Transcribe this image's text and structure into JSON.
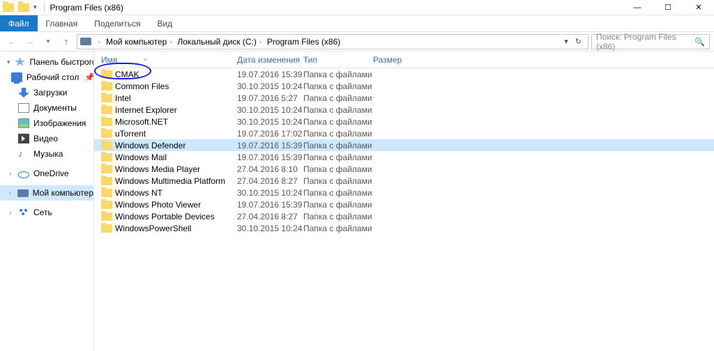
{
  "window": {
    "title": "Program Files (x86)"
  },
  "tabs": {
    "file": "Файл",
    "home": "Главная",
    "share": "Поделиться",
    "view": "Вид"
  },
  "breadcrumb": [
    {
      "label": "Мой компьютер"
    },
    {
      "label": "Локальный диск (C:)"
    },
    {
      "label": "Program Files (x86)"
    }
  ],
  "search": {
    "placeholder": "Поиск: Program Files (x86)"
  },
  "sidebar": {
    "quick": {
      "label": "Панель быстрого доступа"
    },
    "desktop": "Рабочий стол",
    "downloads": "Загрузки",
    "documents": "Документы",
    "pictures": "Изображения",
    "videos": "Видео",
    "music": "Музыка",
    "onedrive": "OneDrive",
    "thispc": "Мой компьютер",
    "network": "Сеть"
  },
  "headers": {
    "name": "Имя",
    "date": "Дата изменения",
    "type": "Тип",
    "size": "Размер"
  },
  "items": [
    {
      "name": "CMAK",
      "date": "19.07.2016 15:39",
      "type": "Папка с файлами"
    },
    {
      "name": "Common Files",
      "date": "30.10.2015 10:24",
      "type": "Папка с файлами"
    },
    {
      "name": "Intel",
      "date": "19.07.2016 5:27",
      "type": "Папка с файлами"
    },
    {
      "name": "Internet Explorer",
      "date": "30.10.2015 10:24",
      "type": "Папка с файлами"
    },
    {
      "name": "Microsoft.NET",
      "date": "30.10.2015 10:24",
      "type": "Папка с файлами"
    },
    {
      "name": "uTorrent",
      "date": "19.07.2016 17:02",
      "type": "Папка с файлами"
    },
    {
      "name": "Windows Defender",
      "date": "19.07.2016 15:39",
      "type": "Папка с файлами"
    },
    {
      "name": "Windows Mail",
      "date": "19.07.2016 15:39",
      "type": "Папка с файлами"
    },
    {
      "name": "Windows Media Player",
      "date": "27.04.2016 8:10",
      "type": "Папка с файлами"
    },
    {
      "name": "Windows Multimedia Platform",
      "date": "27.04.2016 8:27",
      "type": "Папка с файлами"
    },
    {
      "name": "Windows NT",
      "date": "30.10.2015 10:24",
      "type": "Папка с файлами"
    },
    {
      "name": "Windows Photo Viewer",
      "date": "19.07.2016 15:39",
      "type": "Папка с файлами"
    },
    {
      "name": "Windows Portable Devices",
      "date": "27.04.2016 8:27",
      "type": "Папка с файлами"
    },
    {
      "name": "WindowsPowerShell",
      "date": "30.10.2015 10:24",
      "type": "Папка с файлами"
    }
  ],
  "selected_index": 6
}
